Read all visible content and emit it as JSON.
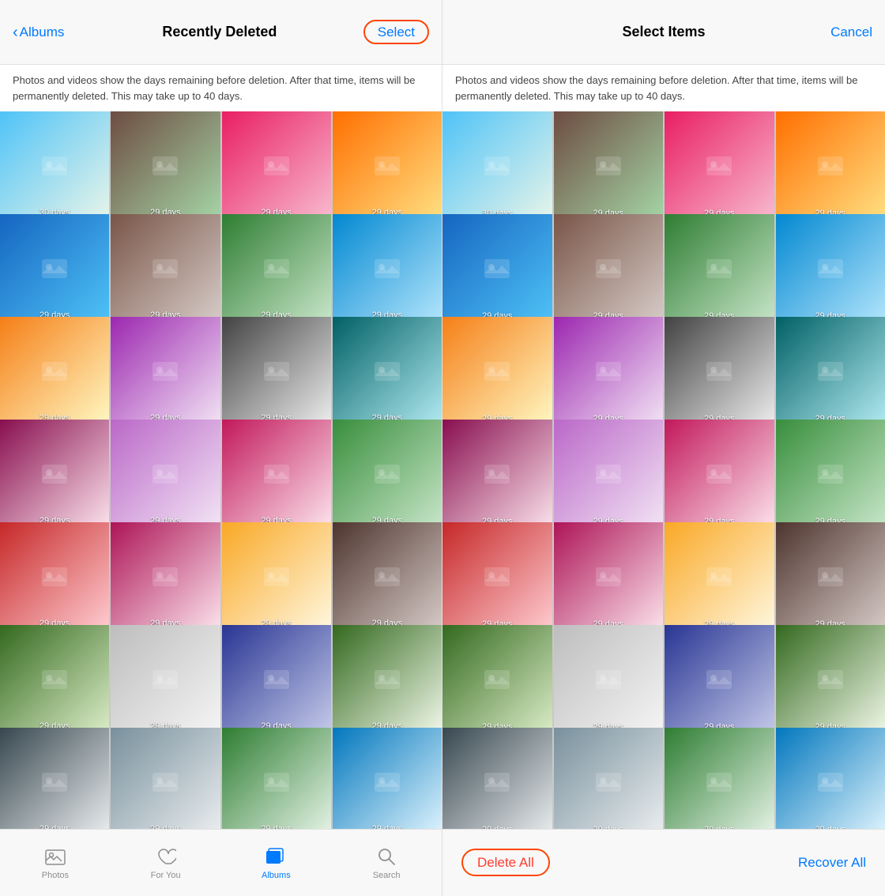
{
  "left_panel": {
    "header": {
      "back_label": "Albums",
      "title": "Recently Deleted",
      "select_label": "Select"
    },
    "info_text": "Photos and videos show the days remaining before deletion. After that time, items will be permanently deleted. This may take up to 40 days.",
    "photos": [
      {
        "days": "30 days"
      },
      {
        "days": "29 days"
      },
      {
        "days": "29 days"
      },
      {
        "days": "29 days"
      },
      {
        "days": "29 days"
      },
      {
        "days": "29 days"
      },
      {
        "days": "29 days"
      },
      {
        "days": "29 days"
      },
      {
        "days": "29 days"
      },
      {
        "days": "29 days"
      },
      {
        "days": "29 days"
      },
      {
        "days": "29 days"
      },
      {
        "days": "29 days"
      },
      {
        "days": "29 days"
      },
      {
        "days": "29 days"
      },
      {
        "days": "29 days"
      },
      {
        "days": "29 days"
      },
      {
        "days": "29 days"
      },
      {
        "days": "29 days"
      },
      {
        "days": "29 days"
      },
      {
        "days": "29 days"
      },
      {
        "days": "29 days"
      },
      {
        "days": "29 days"
      },
      {
        "days": "29 days"
      },
      {
        "days": "29 days"
      },
      {
        "days": "29 days"
      },
      {
        "days": "29 days"
      },
      {
        "days": "29 days"
      }
    ],
    "tab_bar": {
      "tabs": [
        {
          "id": "photos",
          "label": "Photos",
          "active": false
        },
        {
          "id": "for-you",
          "label": "For You",
          "active": false
        },
        {
          "id": "albums",
          "label": "Albums",
          "active": true
        },
        {
          "id": "search",
          "label": "Search",
          "active": false
        }
      ]
    }
  },
  "right_panel": {
    "header": {
      "title": "Select Items",
      "cancel_label": "Cancel"
    },
    "info_text": "Photos and videos show the days remaining before deletion. After that time, items will be permanently deleted. This may take up to 40 days.",
    "photos": [
      {
        "days": "30 days"
      },
      {
        "days": "29 days"
      },
      {
        "days": "29 days"
      },
      {
        "days": "29 days"
      },
      {
        "days": "29 days"
      },
      {
        "days": "29 days"
      },
      {
        "days": "29 days"
      },
      {
        "days": "29 days"
      },
      {
        "days": "29 days"
      },
      {
        "days": "29 days"
      },
      {
        "days": "29 days"
      },
      {
        "days": "29 days"
      },
      {
        "days": "29 days"
      },
      {
        "days": "29 days"
      },
      {
        "days": "29 days"
      },
      {
        "days": "29 days"
      },
      {
        "days": "29 days"
      },
      {
        "days": "29 days"
      },
      {
        "days": "29 days"
      },
      {
        "days": "29 days"
      },
      {
        "days": "29 days"
      },
      {
        "days": "29 days"
      },
      {
        "days": "29 days"
      },
      {
        "days": "29 days"
      },
      {
        "days": "29 days"
      },
      {
        "days": "29 days"
      },
      {
        "days": "29 days"
      },
      {
        "days": "29 days"
      }
    ],
    "select_bar": {
      "delete_all_label": "Delete All",
      "recover_all_label": "Recover All"
    }
  }
}
